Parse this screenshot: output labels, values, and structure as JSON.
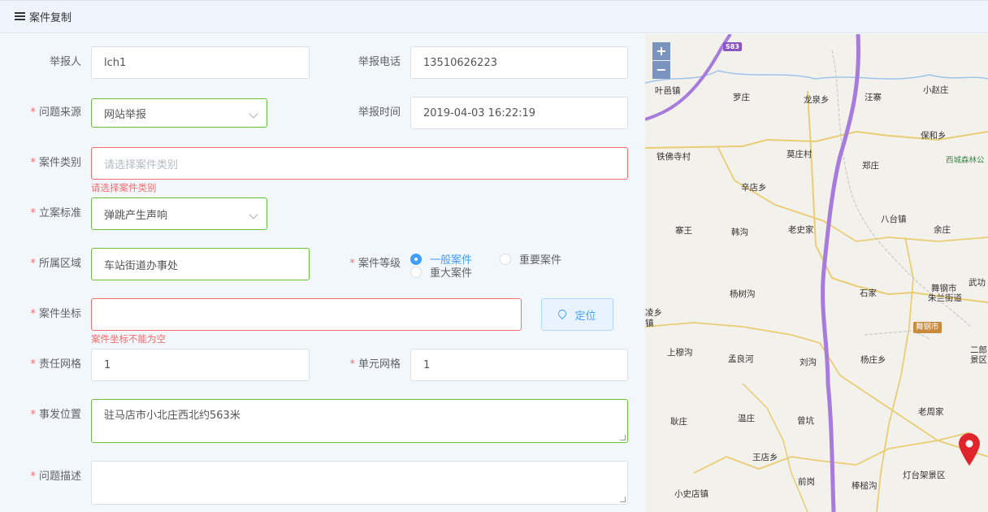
{
  "header": {
    "title": "案件复制",
    "icon": "menu-icon"
  },
  "form": {
    "reporter": {
      "label": "举报人",
      "value": "lch1"
    },
    "phone": {
      "label": "举报电话",
      "value": "13510626223"
    },
    "source": {
      "label": "问题来源",
      "value": "网站举报"
    },
    "report_time": {
      "label": "举报时间",
      "value": "2019-04-03 16:22:19"
    },
    "category": {
      "label": "案件类别",
      "placeholder": "请选择案件类别",
      "error": "请选择案件类别"
    },
    "standard": {
      "label": "立案标准",
      "value": "弹跳产生声响"
    },
    "area": {
      "label": "所属区域",
      "value": "车站街道办事处"
    },
    "level": {
      "label": "案件等级",
      "options": [
        "一般案件",
        "重要案件",
        "重大案件"
      ],
      "selected": "一般案件"
    },
    "coords": {
      "label": "案件坐标",
      "value": "",
      "error": "案件坐标不能为空",
      "locate_label": "定位"
    },
    "duty_grid": {
      "label": "责任网格",
      "value": "1"
    },
    "unit_grid": {
      "label": "单元网格",
      "value": "1"
    },
    "location": {
      "label": "事发位置",
      "value": "驻马店市小北庄西北约563米"
    },
    "description": {
      "label": "问题描述",
      "value": ""
    }
  },
  "map": {
    "zoom_in": "+",
    "zoom_out": "−",
    "highway": "S83",
    "city_badge": "舞钢市",
    "places": [
      "叶邑镇",
      "罗庄",
      "龙泉乡",
      "汪寨",
      "小赵庄",
      "保和乡",
      "西城森林公",
      "铁佛寺村",
      "莫庄村",
      "郑庄",
      "辛店乡",
      "八台镇",
      "寨王",
      "韩沟",
      "老史家",
      "余庄",
      "武功",
      "舞钢市",
      "朱兰街道",
      "杨树沟",
      "石家",
      "凌乡",
      "镇",
      "上穆沟",
      "孟良河",
      "刘沟",
      "杨庄乡",
      "二郎",
      "景区",
      "老周家",
      "耿庄",
      "温庄",
      "曾坑",
      "王店乡",
      "前岗",
      "棒槌沟",
      "灯台架景区",
      "小史店镇"
    ],
    "marker_color": "#e0242b"
  },
  "colors": {
    "required": "#f56c6c",
    "primary": "#409eff",
    "success": "#67c23a"
  }
}
